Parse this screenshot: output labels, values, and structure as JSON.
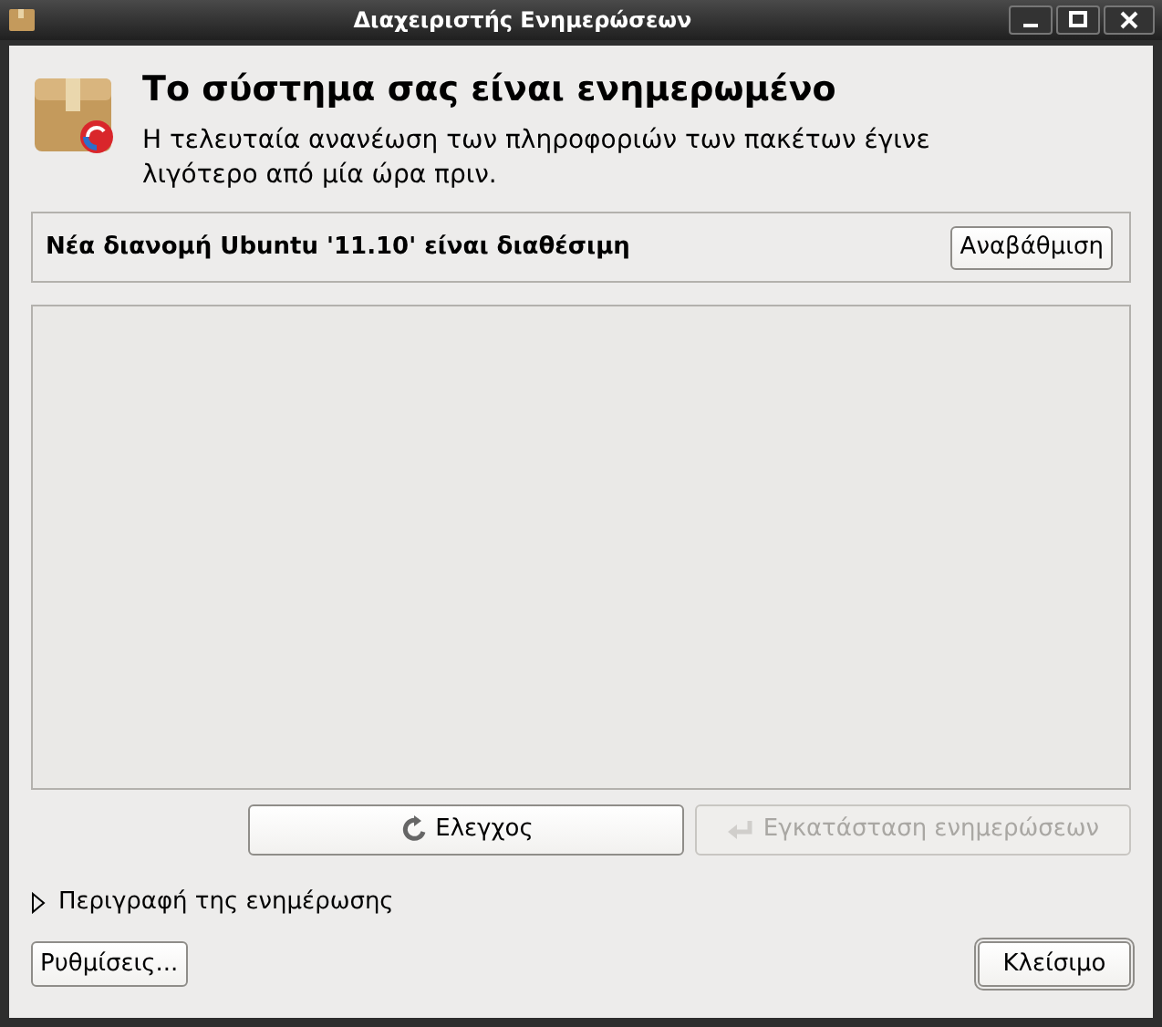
{
  "window": {
    "title": "Διαχειριστής Ενημερώσεων"
  },
  "header": {
    "title": "Το σύστημα σας είναι ενημερωμένο",
    "subtitle": "Η τελευταία ανανέωση των πληροφοριών των πακέτων έγινε λιγότερο από μία ώρα πριν."
  },
  "upgrade_panel": {
    "message": "Νέα διανομή Ubuntu '11.10' είναι διαθέσιμη",
    "button": "Αναβάθμιση"
  },
  "actions": [
    {
      "label": "Ελεγχος",
      "disabled": false
    },
    {
      "label": "Εγκατάσταση ενημερώσεων",
      "disabled": true
    }
  ],
  "expander": {
    "label": "Περιγραφή της ενημέρωσης",
    "expanded": false
  },
  "footer": {
    "settings_button": "Ρυθμίσεις...",
    "close_button": "Κλείσιμο"
  }
}
